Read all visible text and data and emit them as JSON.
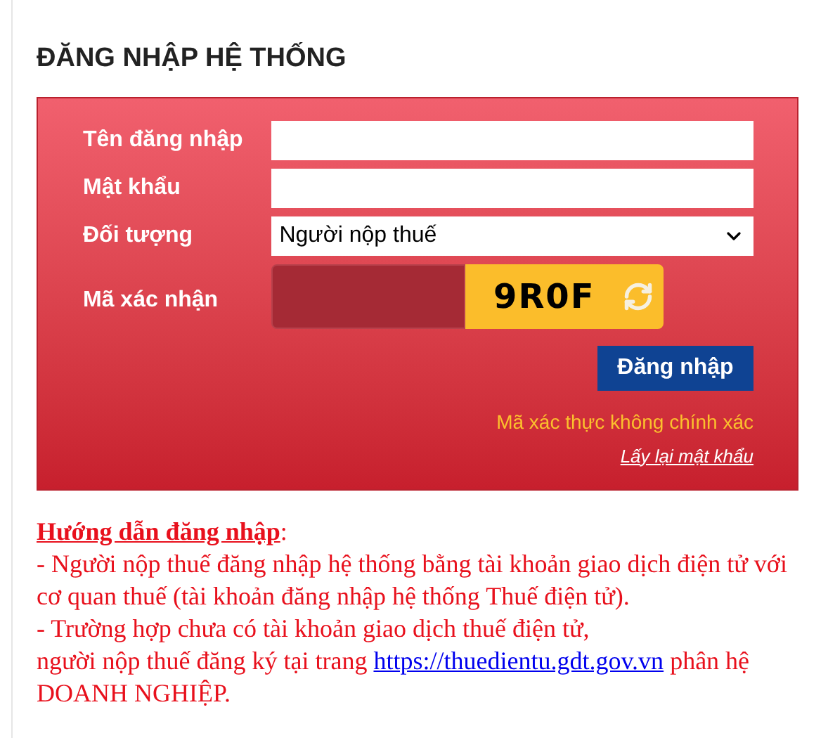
{
  "title": "ĐĂNG NHẬP HỆ THỐNG",
  "form": {
    "fields": [
      {
        "kind": "text",
        "label": "Tên đăng nhập"
      },
      {
        "kind": "password",
        "label": "Mật khẩu"
      },
      {
        "kind": "select",
        "label": "Đối tượng",
        "value": "Người nộp thuế"
      },
      {
        "kind": "captcha",
        "label": "Mã xác nhận",
        "code": "9R0F"
      }
    ],
    "submit": "Đăng nhập",
    "error": "Mã xác thực không chính xác",
    "forgot_link": "Lấy lại mật khẩu"
  },
  "guide": {
    "heading": "Hướng dẫn đăng nhập",
    "heading_suffix": ":",
    "lines": [
      {
        "text": "- Người nộp thuế đăng nhập hệ thống bằng tài khoản giao dịch điện tử với cơ quan thuế (tài khoản đăng nhập hệ thống Thuế điện tử)."
      },
      {
        "text": "- Trường hợp chưa có tài khoản giao dịch thuế điện tử,"
      },
      {
        "text": "người nộp thuế đăng ký tại trang",
        "link": "https://thuedientu.gdt.gov.vn",
        "after": "phân hệ DOANH NGHIỆP."
      }
    ]
  }
}
